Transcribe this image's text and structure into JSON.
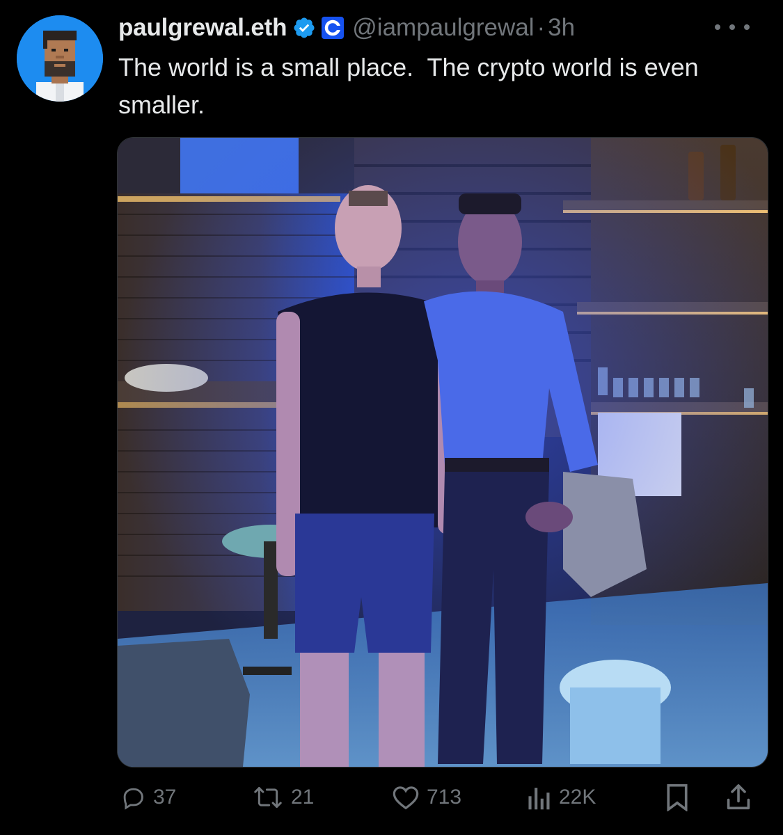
{
  "author": {
    "display_name": "paulgrewal.eth",
    "handle": "@iampaulgrewal",
    "separator": "·",
    "time": "3h",
    "avatar_icon": "pixel-avatar",
    "verified_icon": "verified-badge-icon",
    "affiliate_icon": "coinbase-affiliate-icon"
  },
  "tweet": {
    "text": "The world is a small place.  The crypto world is even smaller."
  },
  "media": {
    "type": "photo"
  },
  "actions": {
    "reply_count": "37",
    "repost_count": "21",
    "like_count": "713",
    "views_count": "22K",
    "bookmark_icon": "bookmark-icon",
    "share_icon": "share-icon"
  },
  "colors": {
    "background": "#000000",
    "text_primary": "#e7e9ea",
    "text_secondary": "#71767b",
    "verified_blue": "#1d9bf0",
    "avatar_bg": "#1d8cf0"
  }
}
